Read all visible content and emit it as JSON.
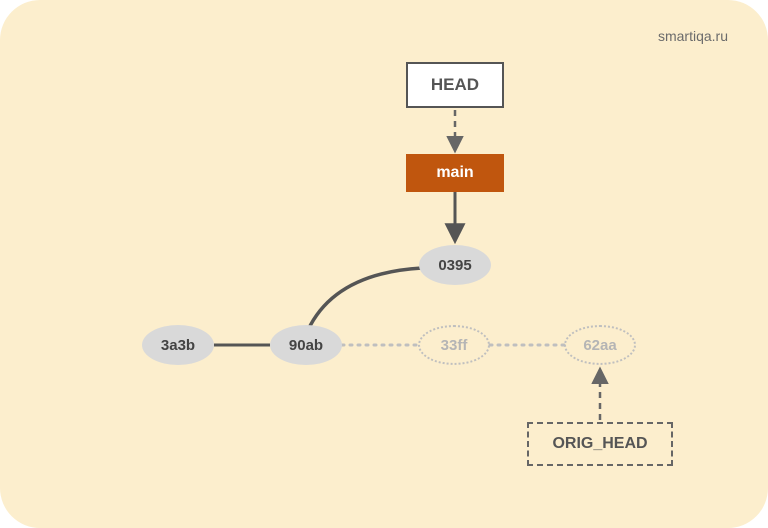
{
  "watermark": "smartiqa.ru",
  "pointers": {
    "head_label": "HEAD",
    "main_label": "main",
    "orig_head_label": "ORIG_HEAD"
  },
  "commits": {
    "c1": "3a3b",
    "c2": "90ab",
    "c3": "0395",
    "g1": "33ff",
    "g2": "62aa"
  },
  "chart_data": {
    "type": "diagram",
    "description": "Git commit graph after reset/merge. HEAD -> main -> 0395. Linear history 3a3b -> 90ab, branch to 0395. Abandoned path 90ab .. 33ff .. 62aa (dotted). ORIG_HEAD -> 62aa.",
    "nodes": [
      {
        "id": "3a3b",
        "type": "commit",
        "state": "reachable"
      },
      {
        "id": "90ab",
        "type": "commit",
        "state": "reachable"
      },
      {
        "id": "0395",
        "type": "commit",
        "state": "reachable"
      },
      {
        "id": "33ff",
        "type": "commit",
        "state": "unreachable"
      },
      {
        "id": "62aa",
        "type": "commit",
        "state": "unreachable"
      },
      {
        "id": "HEAD",
        "type": "ref"
      },
      {
        "id": "main",
        "type": "branch"
      },
      {
        "id": "ORIG_HEAD",
        "type": "ref"
      }
    ],
    "edges": [
      {
        "from": "HEAD",
        "to": "main",
        "style": "dashed-arrow"
      },
      {
        "from": "main",
        "to": "0395",
        "style": "solid-arrow"
      },
      {
        "from": "0395",
        "to": "90ab",
        "style": "solid-curve"
      },
      {
        "from": "90ab",
        "to": "3a3b",
        "style": "solid"
      },
      {
        "from": "33ff",
        "to": "90ab",
        "style": "dotted"
      },
      {
        "from": "62aa",
        "to": "33ff",
        "style": "dotted"
      },
      {
        "from": "ORIG_HEAD",
        "to": "62aa",
        "style": "dashed-arrow"
      }
    ]
  }
}
